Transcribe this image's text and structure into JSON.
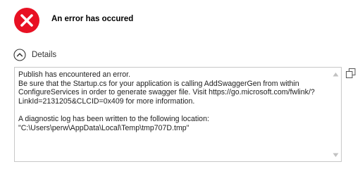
{
  "dialog": {
    "title": "An error has occured",
    "error_icon": "error-circle-x-icon",
    "colors": {
      "error_red": "#e81123",
      "border": "#c8c8c8",
      "text": "#1e1e1e"
    }
  },
  "details": {
    "label": "Details",
    "toggle_icon": "chevron-up-icon",
    "lines": [
      "Publish has encountered an error.",
      "Be sure that the Startup.cs for your application is calling AddSwaggerGen from within",
      "ConfigureServices in order to generate swagger file. Visit https://go.microsoft.com/fwlink/?",
      "LinkId=2131205&CLCID=0x409 for more information.",
      "",
      "A diagnostic log has been written to the following location:",
      "\"C:\\Users\\perw\\AppData\\Local\\Temp\\tmp707D.tmp\""
    ],
    "copy_icon": "copy-icon"
  }
}
